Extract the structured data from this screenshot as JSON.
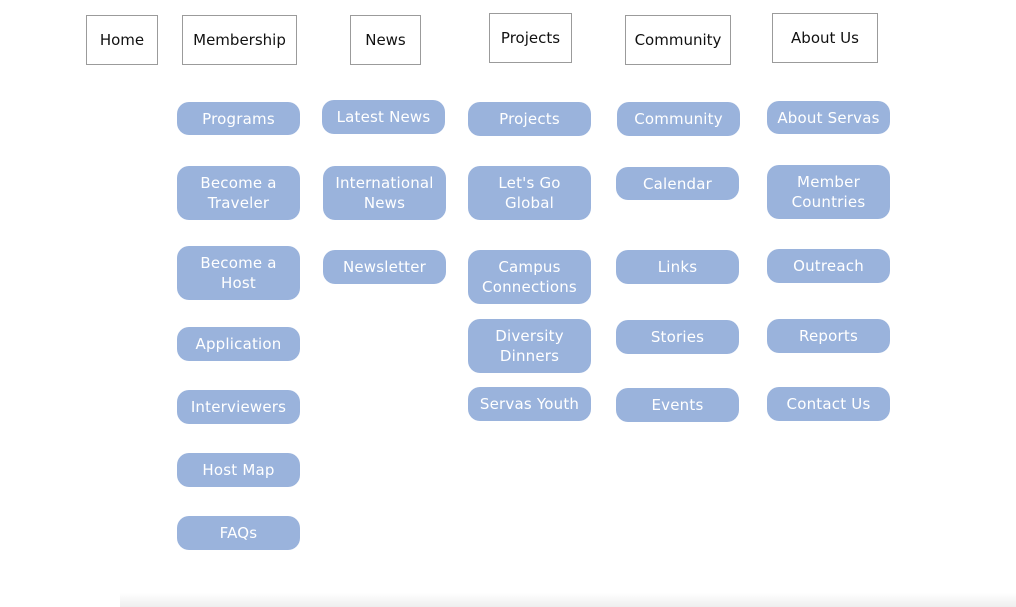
{
  "colors": {
    "pill_background": "#9ab3dc",
    "pill_text": "#ffffff",
    "top_border": "#9b9b9b"
  },
  "top_nav": {
    "home": "Home",
    "membership": "Membership",
    "news": "News",
    "projects": "Projects",
    "community": "Community",
    "about_us": "About Us"
  },
  "membership_menu": {
    "programs": "Programs",
    "become_traveler": "Become a Traveler",
    "become_host": "Become a Host",
    "application": "Application",
    "interviewers": "Interviewers",
    "host_map": "Host Map",
    "faqs": "FAQs"
  },
  "news_menu": {
    "latest_news": "Latest News",
    "international_news": "International News",
    "newsletter": "Newsletter"
  },
  "projects_menu": {
    "projects": "Projects",
    "lets_go_global": "Let's Go Global",
    "campus_connections": "Campus Connections",
    "diversity_dinners": "Diversity Dinners",
    "servas_youth": "Servas Youth"
  },
  "community_menu": {
    "community": "Community",
    "calendar": "Calendar",
    "links": "Links",
    "stories": "Stories",
    "events": "Events"
  },
  "about_menu": {
    "about_servas": "About Servas",
    "member_countries": "Member Countries",
    "outreach": "Outreach",
    "reports": "Reports",
    "contact_us": "Contact Us"
  }
}
